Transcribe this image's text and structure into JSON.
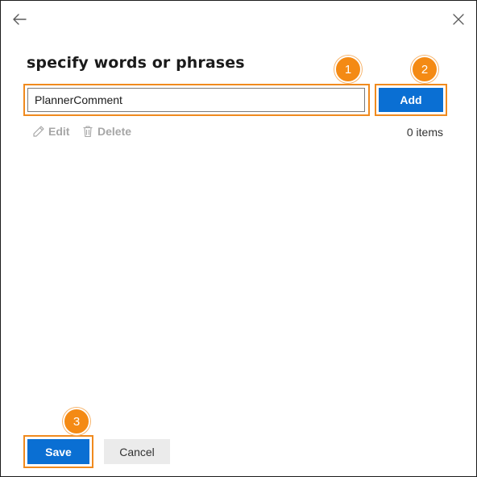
{
  "dialog": {
    "title": "specify words or phrases"
  },
  "form": {
    "input_value": "PlannerComment",
    "add_label": "Add"
  },
  "toolbar": {
    "edit_label": "Edit",
    "delete_label": "Delete",
    "items_count": "0 items"
  },
  "footer": {
    "save_label": "Save",
    "cancel_label": "Cancel"
  },
  "callouts": {
    "one": "1",
    "two": "2",
    "three": "3"
  },
  "icons": {
    "back": "arrow-left-icon",
    "close": "close-icon",
    "edit": "pencil-icon",
    "delete": "trash-icon"
  },
  "colors": {
    "primary": "#0a6fd3",
    "callout": "#f48a14",
    "highlight": "#f08a1e",
    "disabled_text": "#a6a6a6"
  }
}
